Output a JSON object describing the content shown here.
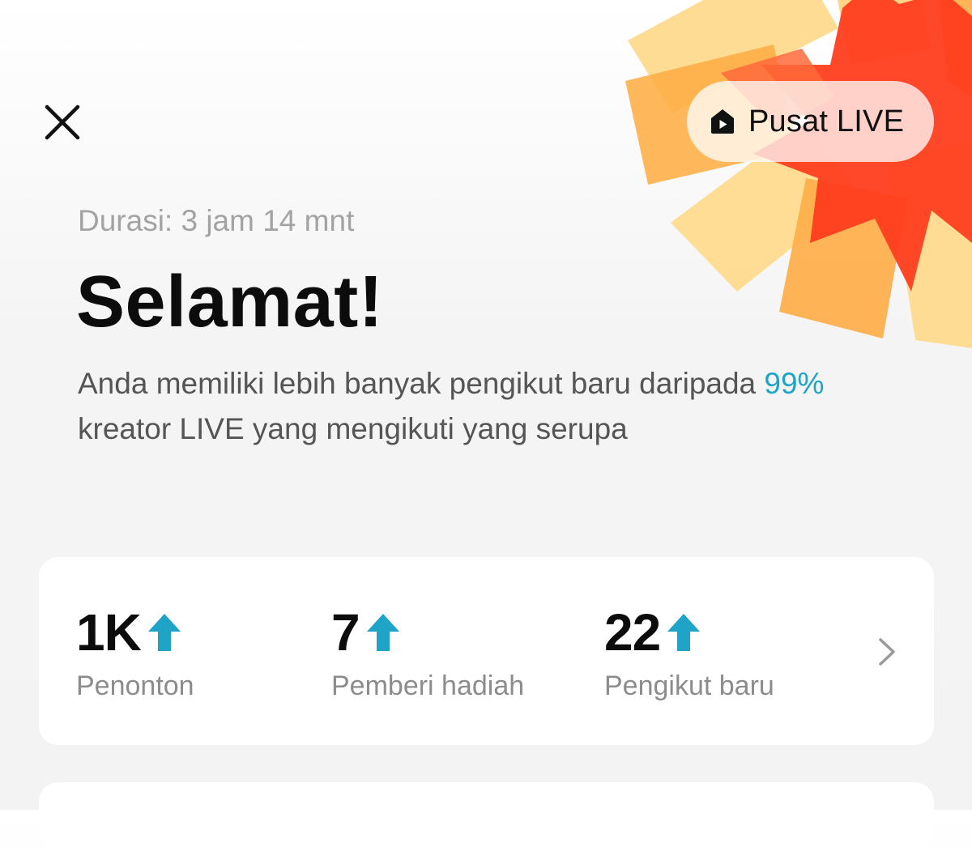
{
  "header": {
    "live_center_label": "Pusat LIVE"
  },
  "summary": {
    "duration": "Durasi: 3 jam 14 mnt",
    "title": "Selamat!",
    "description_part1": "Anda memiliki lebih banyak pengikut baru daripada ",
    "highlight_percent": "99%",
    "description_part2": " kreator LIVE yang mengikuti yang serupa"
  },
  "stats": [
    {
      "value": "1K",
      "label": "Penonton",
      "trend": "up"
    },
    {
      "value": "7",
      "label": "Pemberi hadiah",
      "trend": "up"
    },
    {
      "value": "22",
      "label": "Pengikut baru",
      "trend": "up"
    }
  ],
  "icons": {
    "close": "close-icon",
    "live_center": "live-house-icon",
    "trend": "arrow-up-icon",
    "more": "chevron-right-icon"
  },
  "colors": {
    "accent": "#1fa4c7",
    "title": "#0c0c0c",
    "muted": "#a3a3a3",
    "decor_red": "#ff3a1f",
    "decor_orange": "#ffa63d",
    "decor_yellow": "#ffd56b"
  }
}
